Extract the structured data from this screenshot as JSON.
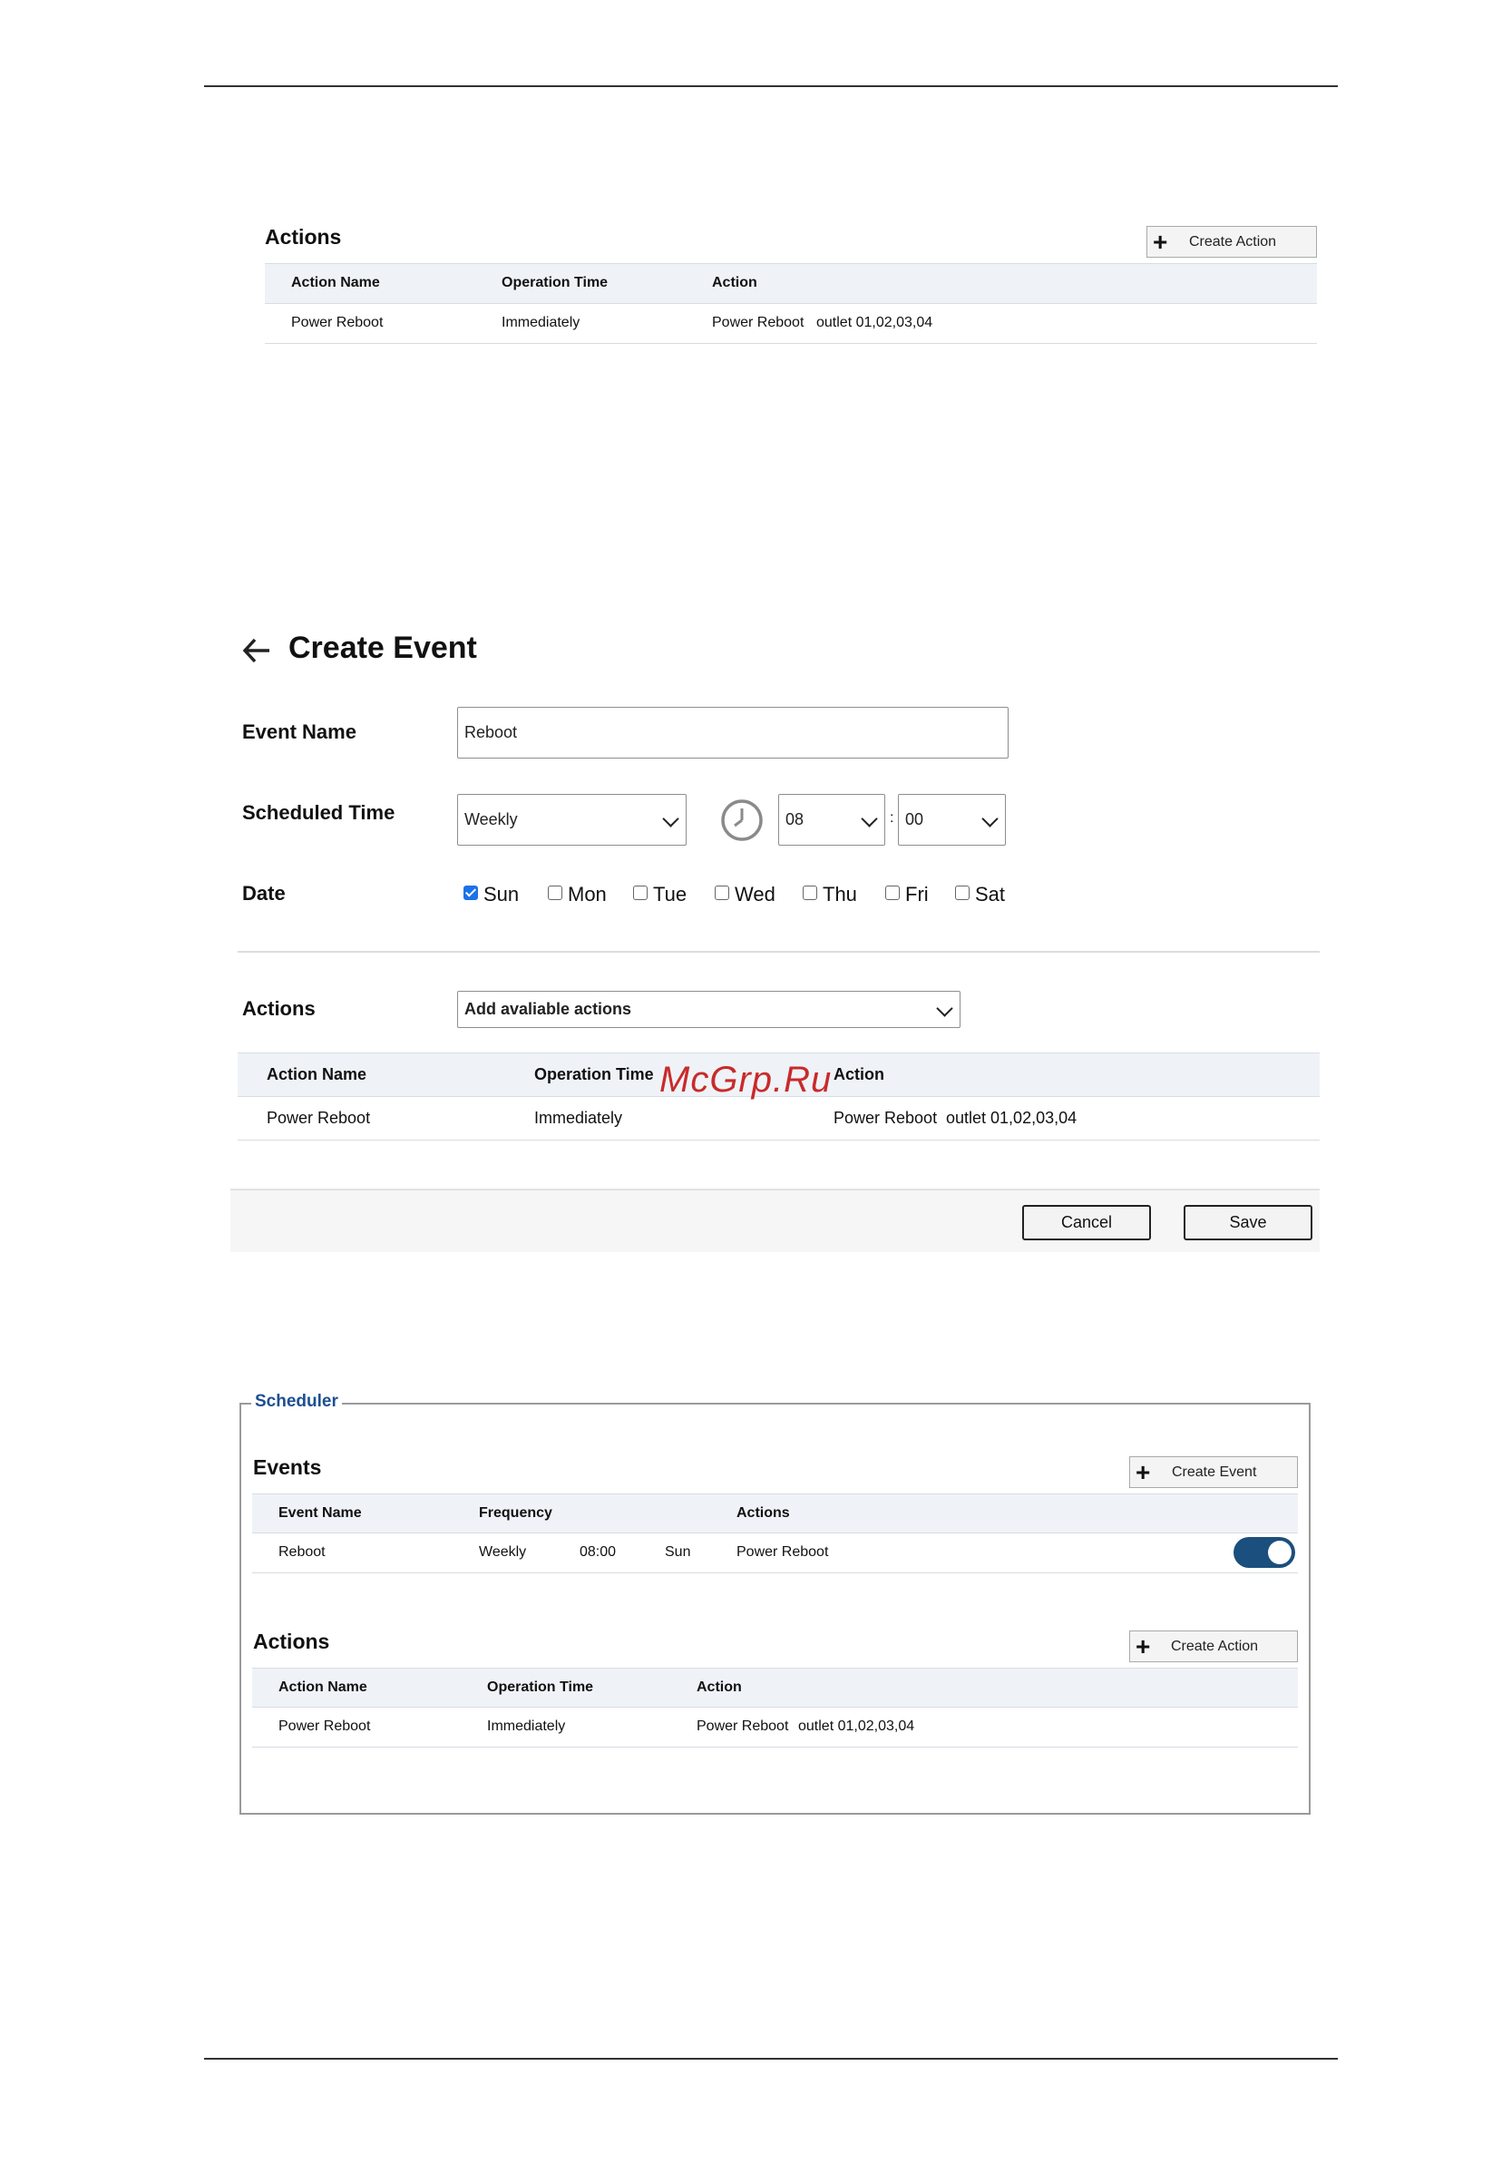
{
  "top_actions": {
    "title": "Actions",
    "create_button": "Create Action",
    "columns": [
      "Action Name",
      "Operation Time",
      "Action"
    ],
    "rows": [
      {
        "name": "Power Reboot",
        "time": "Immediately",
        "action": "Power Reboot",
        "outlets": "outlet 01,02,03,04"
      }
    ]
  },
  "create_event": {
    "title": "Create Event",
    "event_name_label": "Event Name",
    "event_name_value": "Reboot",
    "scheduled_time_label": "Scheduled Time",
    "frequency_value": "Weekly",
    "hour_value": "08",
    "time_separator": ":",
    "minute_value": "00",
    "date_label": "Date",
    "days": [
      {
        "label": "Sun",
        "checked": true
      },
      {
        "label": "Mon",
        "checked": false
      },
      {
        "label": "Tue",
        "checked": false
      },
      {
        "label": "Wed",
        "checked": false
      },
      {
        "label": "Thu",
        "checked": false
      },
      {
        "label": "Fri",
        "checked": false
      },
      {
        "label": "Sat",
        "checked": false
      }
    ],
    "actions_label": "Actions",
    "actions_select": "Add avaliable actions",
    "columns": [
      "Action Name",
      "Operation Time",
      "Action"
    ],
    "rows": [
      {
        "name": "Power Reboot",
        "time": "Immediately",
        "action": "Power Reboot",
        "outlets": "outlet 01,02,03,04"
      }
    ],
    "cancel_label": "Cancel",
    "save_label": "Save"
  },
  "watermark": "McGrp.Ru",
  "scheduler": {
    "legend": "Scheduler",
    "events_title": "Events",
    "create_event_button": "Create Event",
    "event_columns": [
      "Event Name",
      "Frequency",
      "Actions"
    ],
    "event_rows": [
      {
        "name": "Reboot",
        "frequency": "Weekly",
        "time": "08:00",
        "day": "Sun",
        "actions": "Power Reboot",
        "enabled": true
      }
    ],
    "actions_title": "Actions",
    "create_action_button": "Create Action",
    "action_columns": [
      "Action Name",
      "Operation Time",
      "Action"
    ],
    "action_rows": [
      {
        "name": "Power Reboot",
        "time": "Immediately",
        "action": "Power Reboot",
        "outlets": "outlet 01,02,03,04"
      }
    ]
  },
  "colors": {
    "toggle_on": "#1b4f7d",
    "legend": "#1d4f91",
    "checkbox_on": "#1a73e8",
    "watermark": "#c92a2a"
  }
}
